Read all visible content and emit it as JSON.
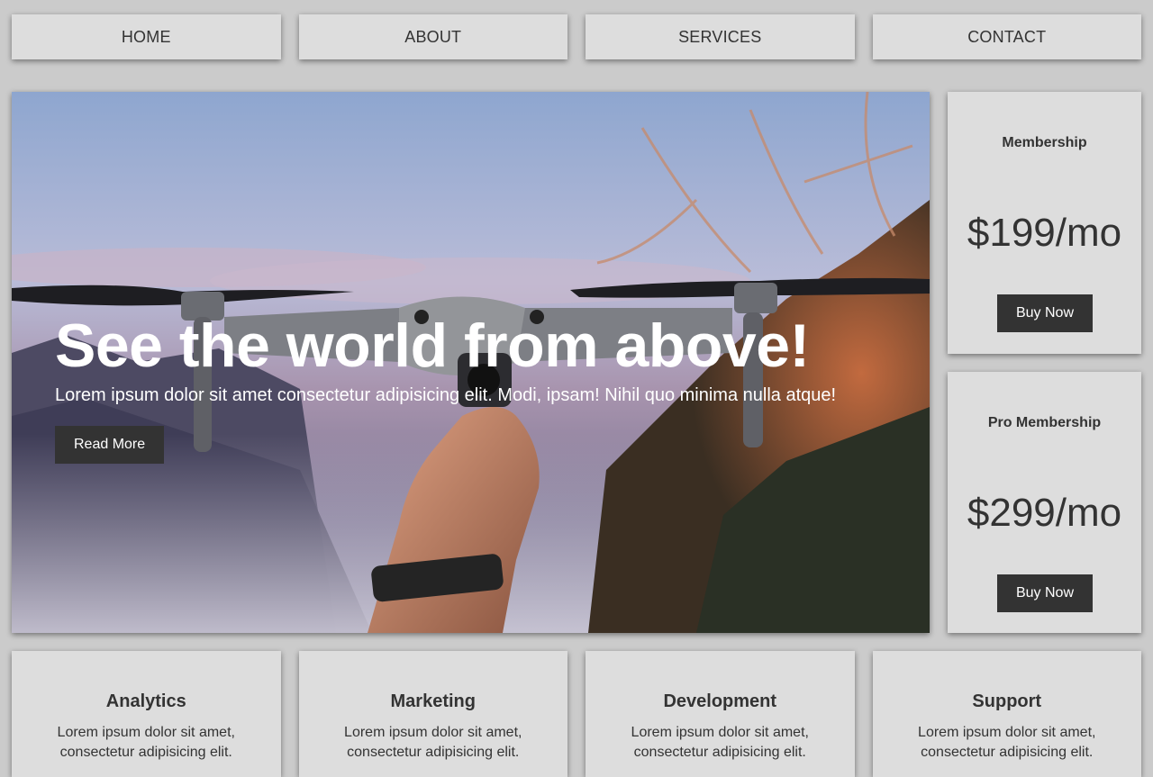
{
  "nav": {
    "items": [
      {
        "label": "HOME"
      },
      {
        "label": "ABOUT"
      },
      {
        "label": "SERVICES"
      },
      {
        "label": "CONTACT"
      }
    ]
  },
  "hero": {
    "title": "See the world from above!",
    "text": "Lorem ipsum dolor sit amet consectetur adipisicing elit. Modi, ipsam! Nihil quo minima nulla atque!",
    "button": "Read More"
  },
  "pricing": [
    {
      "name": "Membership",
      "price": "$199/mo",
      "button": "Buy Now"
    },
    {
      "name": "Pro Membership",
      "price": "$299/mo",
      "button": "Buy Now"
    }
  ],
  "services": [
    {
      "title": "Analytics",
      "text": "Lorem ipsum dolor sit amet, consectetur adipisicing elit."
    },
    {
      "title": "Marketing",
      "text": "Lorem ipsum dolor sit amet, consectetur adipisicing elit."
    },
    {
      "title": "Development",
      "text": "Lorem ipsum dolor sit amet, consectetur adipisicing elit."
    },
    {
      "title": "Support",
      "text": "Lorem ipsum dolor sit amet, consectetur adipisicing elit."
    }
  ],
  "colors": {
    "background": "#cbcbcb",
    "card": "#dddddd",
    "button": "#333333",
    "text": "#333333"
  }
}
